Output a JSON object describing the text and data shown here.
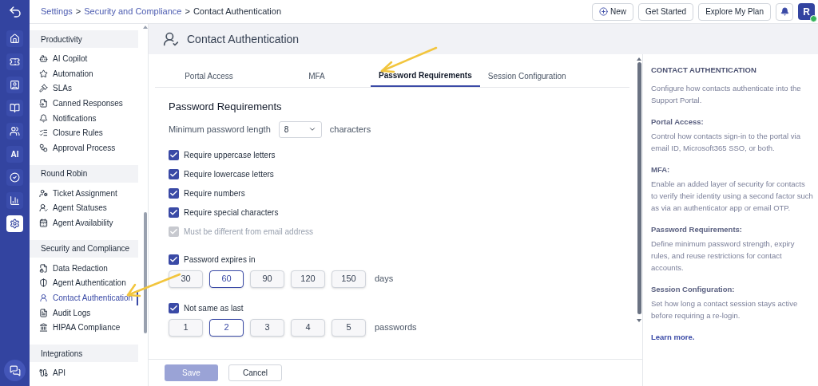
{
  "rail": {
    "items": [
      {
        "kind": "icon",
        "selected": false
      },
      {
        "kind": "icon",
        "selected": false
      },
      {
        "kind": "icon",
        "selected": false
      },
      {
        "kind": "icon",
        "selected": false
      },
      {
        "kind": "icon",
        "selected": false
      },
      {
        "kind": "text",
        "label": "AI",
        "selected": false
      },
      {
        "kind": "icon",
        "selected": false
      },
      {
        "kind": "icon",
        "selected": false
      },
      {
        "kind": "icon",
        "selected": true
      }
    ]
  },
  "breadcrumb": [
    {
      "label": "Settings",
      "link": true
    },
    {
      "label": ">",
      "link": false
    },
    {
      "label": "Security and Compliance",
      "link": true
    },
    {
      "label": ">",
      "link": false
    },
    {
      "label": "Contact Authentication",
      "link": false
    }
  ],
  "header_buttons": [
    {
      "label": "New"
    },
    {
      "label": "Get Started"
    },
    {
      "label": "Explore My Plan"
    }
  ],
  "avatar": {
    "initial": "R",
    "online": true
  },
  "sidebar": {
    "sections": [
      {
        "title": "Productivity",
        "items": [
          {
            "label": "AI Copilot",
            "selected": false
          },
          {
            "label": "Automation",
            "selected": false
          },
          {
            "label": "SLAs",
            "selected": false
          },
          {
            "label": "Canned Responses",
            "selected": false
          },
          {
            "label": "Notifications",
            "selected": false
          },
          {
            "label": "Closure Rules",
            "selected": false
          },
          {
            "label": "Approval Process",
            "selected": false
          }
        ]
      },
      {
        "title": "Round Robin",
        "items": [
          {
            "label": "Ticket Assignment",
            "selected": false
          },
          {
            "label": "Agent Statuses",
            "selected": false
          },
          {
            "label": "Agent Availability",
            "selected": false
          }
        ]
      },
      {
        "title": "Security and Compliance",
        "items": [
          {
            "label": "Data Redaction",
            "selected": false
          },
          {
            "label": "Agent Authentication",
            "selected": false
          },
          {
            "label": "Contact Authentication",
            "selected": true
          },
          {
            "label": "Audit Logs",
            "selected": false
          },
          {
            "label": "HIPAA Compliance",
            "selected": false
          }
        ]
      },
      {
        "title": "Integrations",
        "items": [
          {
            "label": "API",
            "selected": false
          }
        ]
      }
    ]
  },
  "page_title": "Contact Authentication",
  "tabs": [
    {
      "label": "Portal Access",
      "selected": false
    },
    {
      "label": "MFA",
      "selected": false
    },
    {
      "label": "Password Requirements",
      "selected": true
    },
    {
      "label": "Session Configuration",
      "selected": false
    }
  ],
  "section_title": "Password Requirements",
  "min_length": {
    "label": "Minimum password length",
    "value": "8",
    "unit": "characters"
  },
  "rules": [
    {
      "label": "Require uppercase letters",
      "checked": true,
      "disabled": false
    },
    {
      "label": "Require lowercase letters",
      "checked": true,
      "disabled": false
    },
    {
      "label": "Require numbers",
      "checked": true,
      "disabled": false
    },
    {
      "label": "Require special characters",
      "checked": true,
      "disabled": false
    },
    {
      "label": "Must be different from email address",
      "checked": true,
      "disabled": true
    }
  ],
  "expiry": {
    "label": "Password expires in",
    "checked": true,
    "options": [
      {
        "label": "30",
        "selected": false
      },
      {
        "label": "60",
        "selected": true
      },
      {
        "label": "90",
        "selected": false
      },
      {
        "label": "120",
        "selected": false
      },
      {
        "label": "150",
        "selected": false
      }
    ],
    "unit": "days"
  },
  "history": {
    "label": "Not same as last",
    "checked": true,
    "options": [
      {
        "label": "1",
        "selected": false
      },
      {
        "label": "2",
        "selected": true
      },
      {
        "label": "3",
        "selected": false
      },
      {
        "label": "4",
        "selected": false
      },
      {
        "label": "5",
        "selected": false
      }
    ],
    "unit": "passwords"
  },
  "footer_buttons": [
    {
      "label": "Save",
      "disabled": true
    },
    {
      "label": "Cancel",
      "disabled": false
    }
  ],
  "help": {
    "title": "CONTACT AUTHENTICATION",
    "intro": "Configure how contacts authenticate into the Support Portal.",
    "topics": [
      {
        "heading": "Portal Access:",
        "text": "Control how contacts sign-in to the portal via email ID, Microsoft365 SSO, or both."
      },
      {
        "heading": "MFA:",
        "text": "Enable an added layer of security for contacts to verify their identity using a second factor such as via an authenticator app or email OTP."
      },
      {
        "heading": "Password Requirements:",
        "text": "Define minimum password strength, expiry rules, and reuse restrictions for contact accounts."
      },
      {
        "heading": "Session Configuration:",
        "text": "Set how long a contact session stays active before requiring a re-login."
      }
    ],
    "link": "Learn more."
  }
}
